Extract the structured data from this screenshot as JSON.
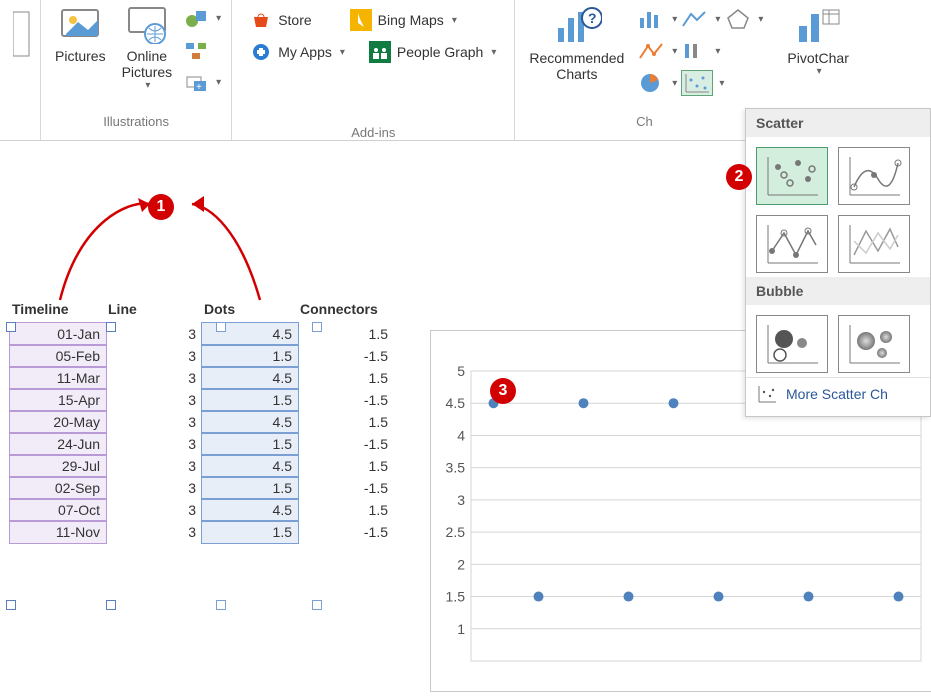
{
  "ribbon": {
    "illustrations": {
      "label": "Illustrations",
      "pictures": "Pictures",
      "online_pictures": "Online\nPictures"
    },
    "addins": {
      "label": "Add-ins",
      "store": "Store",
      "my_apps": "My Apps",
      "bing_maps": "Bing Maps",
      "people_graph": "People Graph"
    },
    "charts": {
      "label": "Ch",
      "recommended": "Recommended\nCharts"
    },
    "pivot": "PivotChar"
  },
  "scatter_panel": {
    "scatter": "Scatter",
    "bubble": "Bubble",
    "more": "More Scatter Ch"
  },
  "annotations": {
    "b1": "1",
    "b2": "2",
    "b3": "3"
  },
  "table": {
    "headers": {
      "timeline": "Timeline",
      "line": "Line",
      "dots": "Dots",
      "connectors": "Connectors"
    },
    "rows": [
      {
        "timeline": "01-Jan",
        "line": 3,
        "dots": 4.5,
        "connectors": 1.5
      },
      {
        "timeline": "05-Feb",
        "line": 3,
        "dots": 1.5,
        "connectors": -1.5
      },
      {
        "timeline": "11-Mar",
        "line": 3,
        "dots": 4.5,
        "connectors": 1.5
      },
      {
        "timeline": "15-Apr",
        "line": 3,
        "dots": 1.5,
        "connectors": -1.5
      },
      {
        "timeline": "20-May",
        "line": 3,
        "dots": 4.5,
        "connectors": 1.5
      },
      {
        "timeline": "24-Jun",
        "line": 3,
        "dots": 1.5,
        "connectors": -1.5
      },
      {
        "timeline": "29-Jul",
        "line": 3,
        "dots": 4.5,
        "connectors": 1.5
      },
      {
        "timeline": "02-Sep",
        "line": 3,
        "dots": 1.5,
        "connectors": -1.5
      },
      {
        "timeline": "07-Oct",
        "line": 3,
        "dots": 4.5,
        "connectors": 1.5
      },
      {
        "timeline": "11-Nov",
        "line": 3,
        "dots": 1.5,
        "connectors": -1.5
      }
    ]
  },
  "chart_data": {
    "type": "scatter",
    "title": "",
    "xlabel": "",
    "ylabel": "",
    "ylim": [
      0.5,
      5
    ],
    "yticks": [
      5,
      4.5,
      4,
      3.5,
      3,
      2.5,
      2,
      1.5,
      1
    ],
    "x": [
      1,
      2,
      3,
      4,
      5,
      6,
      7,
      8,
      9,
      10
    ],
    "y": [
      4.5,
      1.5,
      4.5,
      1.5,
      4.5,
      1.5,
      4.5,
      1.5,
      4.5,
      1.5
    ]
  }
}
